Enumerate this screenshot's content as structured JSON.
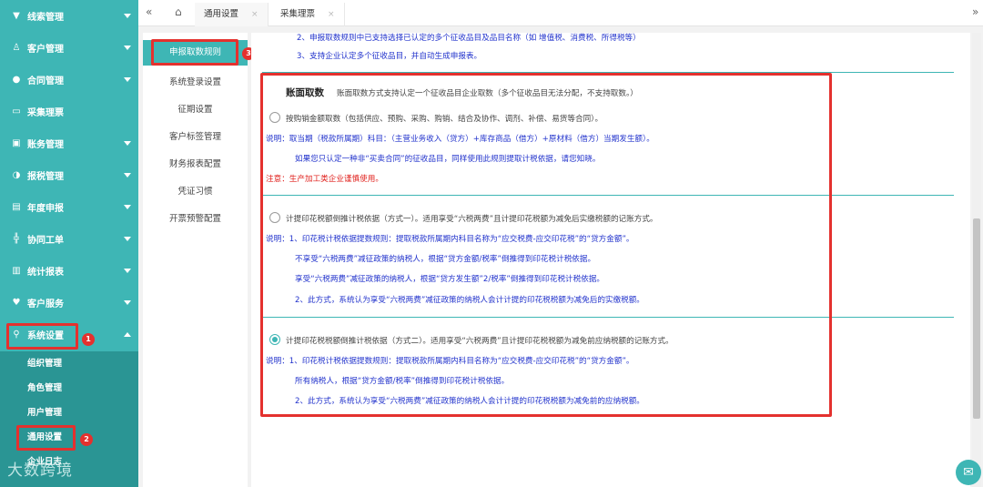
{
  "sidebar": {
    "items": [
      {
        "label": "线索管理",
        "icon": "funnel-icon"
      },
      {
        "label": "客户管理",
        "icon": "user-icon"
      },
      {
        "label": "合同管理",
        "icon": "person-icon"
      },
      {
        "label": "采集理票",
        "icon": "card-icon"
      },
      {
        "label": "账务管理",
        "icon": "building-icon"
      },
      {
        "label": "报税管理",
        "icon": "chart-icon"
      },
      {
        "label": "年度申报",
        "icon": "calendar-icon"
      },
      {
        "label": "协同工单",
        "icon": "org-icon"
      },
      {
        "label": "统计报表",
        "icon": "bar-chart-icon"
      },
      {
        "label": "客户服务",
        "icon": "heart-icon"
      },
      {
        "label": "系统设置",
        "icon": "user-search-icon"
      }
    ],
    "submenu": [
      "组织管理",
      "角色管理",
      "用户管理",
      "通用设置",
      "企业日志"
    ],
    "watermark": "大数跨境",
    "badges": [
      "1",
      "2"
    ]
  },
  "tabs": {
    "items": [
      "通用设置",
      "采集理票"
    ],
    "close_glyph": "×"
  },
  "settings_menu": {
    "items": [
      "申报取数规则",
      "系统登录设置",
      "征期设置",
      "客户标签管理",
      "财务报表配置",
      "凭证习惯",
      "开票预警配置"
    ],
    "badge": "3"
  },
  "content": {
    "top_line1": "2、申报取数规则中已支持选择已认定的多个征收品目及品目名称（如 增值税、消费税、所得税等）",
    "top_line2": "3、支持企业认定多个征收品目，并自动生成申报表。",
    "section_title": "账面取数",
    "section_desc": "账面取数方式支持认定一个征收品目企业取数（多个征收品目无法分配，不支持取数。）",
    "opt1": {
      "label": "按购销金额取数（包括供应、预购、采购、购销、结合及协作、调剂、补偿、易货等合同）。",
      "note1": "说明：取当期（税款所属期）科目：（主营业务收入（贷方）+库存商品（借方）+原材料（借方）当期发生额）。",
      "note2": "如果您只认定一种非“买卖合同”的征收品目，同样使用此规则提取计税依据，请您知晓。",
      "warn": "注意：生产加工类企业谨慎使用。"
    },
    "opt2": {
      "label": "计提印花税额倒推计税依据（方式一）。适用享受“六税两费”且计提印花税额为减免后实缴税额的记账方式。",
      "l1": "说明：1、印花税计税依据提数规则：提取税款所属期内科目名称为“应交税费-应交印花税”的“贷方金额”。",
      "l2": "不享受“六税两费”减征政策的纳税人，根据“贷方金额/税率”倒推得到印花税计税依据。",
      "l3": "享受“六税两费”减征政策的纳税人，根据“贷方发生额”2/税率”倒推得到印花税计税依据。",
      "l4": "2、此方式，系统认为享受“六税两费”减征政策的纳税人会计计提的印花税税额为减免后的实缴税额。"
    },
    "opt3": {
      "label": "计提印花税税额倒推计税依据（方式二）。适用享受“六税两费”且计提印花税税额为减免前应纳税额的记账方式。",
      "l1": "说明：1、印花税计税依据提数规则：提取税款所属期内科目名称为“应交税费-应交印花税”的“贷方金额”。",
      "l2": "所有纳税人，根据“贷方金额/税率”倒推得到印花税计税依据。",
      "l3": "2、此方式，系统认为享受“六税两费”减征政策的纳税人会计计提的印花税税额为减免前的应纳税额。"
    }
  },
  "colors": {
    "accent": "#3eb6b5",
    "highlight": "#e4312e",
    "note_blue": "#2233cc",
    "warn_red": "#e0201c"
  }
}
